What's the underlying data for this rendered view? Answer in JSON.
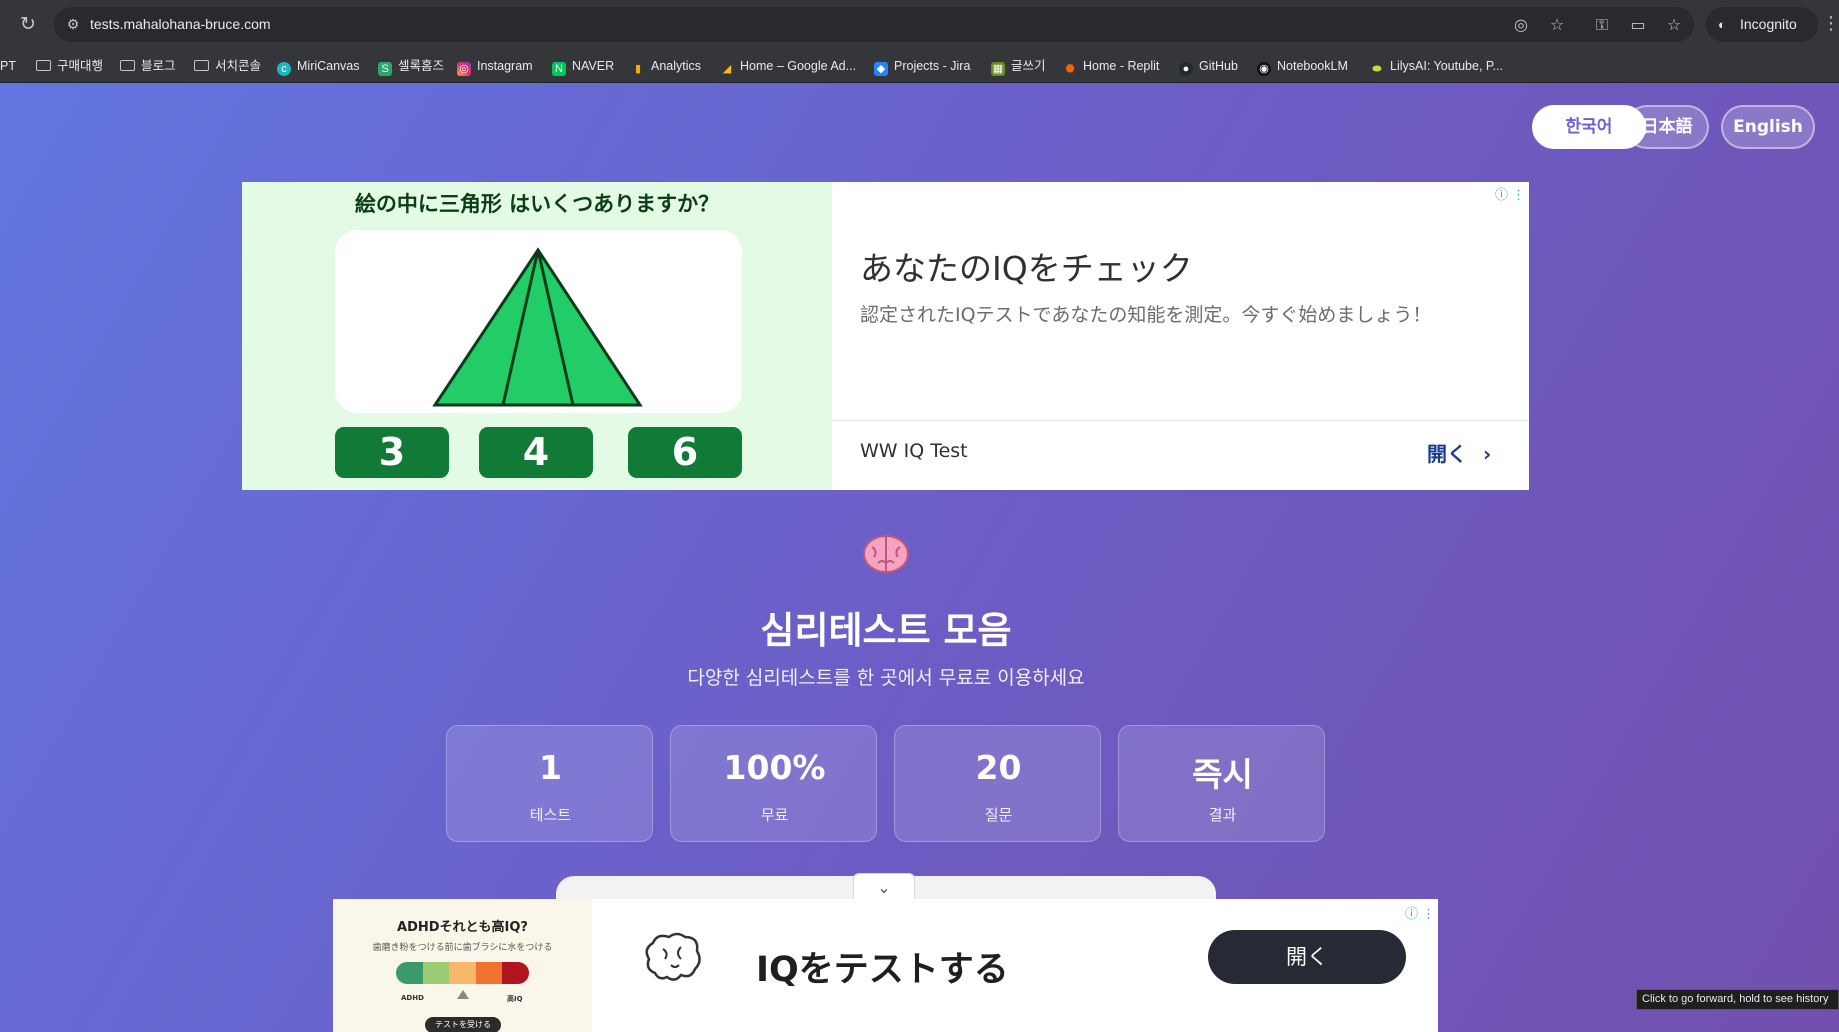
{
  "browser": {
    "url": "tests.mahalohana-bruce.com",
    "incognito_label": "Incognito",
    "tooltip": "Click to go forward, hold to see history",
    "bookmarks": [
      {
        "label": "PT",
        "icon": "none"
      },
      {
        "label": "구매대행",
        "icon": "folder-icon"
      },
      {
        "label": "블로그",
        "icon": "folder-icon"
      },
      {
        "label": "서치콘솔",
        "icon": "folder-icon"
      },
      {
        "label": "MiriCanvas",
        "icon": "miricanvas-icon"
      },
      {
        "label": "셀록홈즈",
        "icon": "sellock-icon"
      },
      {
        "label": "Instagram",
        "icon": "instagram-icon"
      },
      {
        "label": "NAVER",
        "icon": "naver-icon"
      },
      {
        "label": "Analytics",
        "icon": "analytics-icon"
      },
      {
        "label": "Home – Google Ad...",
        "icon": "google-ads-icon"
      },
      {
        "label": "Projects - Jira",
        "icon": "jira-icon"
      },
      {
        "label": "글쓰기",
        "icon": "write-icon"
      },
      {
        "label": "Home - Replit",
        "icon": "replit-icon"
      },
      {
        "label": "GitHub",
        "icon": "github-icon"
      },
      {
        "label": "NotebookLM",
        "icon": "notebooklm-icon"
      },
      {
        "label": "LilysAI: Youtube, P...",
        "icon": "lilys-icon"
      }
    ]
  },
  "languages": [
    {
      "label": "한국어",
      "active": true
    },
    {
      "label": "日本語",
      "active": false
    },
    {
      "label": "English",
      "active": false
    }
  ],
  "ad_top": {
    "question": "絵の中に三角形 はいくつありますか？",
    "answers": [
      "3",
      "4",
      "6"
    ],
    "title": "あなたのIQをチェック",
    "description": "認定されたIQテストであなたの知能を測定。今すぐ始めましょう！",
    "brand": "WW IQ Test",
    "open_label": "開く"
  },
  "hero": {
    "title": "심리테스트 모음",
    "subtitle": "다양한 심리테스트를 한 곳에서 무료로 이용하세요"
  },
  "stats": [
    {
      "value": "1",
      "label": "테스트"
    },
    {
      "value": "100%",
      "label": "무료"
    },
    {
      "value": "20",
      "label": "질문"
    },
    {
      "value": "즉시",
      "label": "결과"
    }
  ],
  "ad_bottom": {
    "image_heading": "ADHDそれとも高IQ?",
    "image_sub": "歯磨き粉をつける前に歯ブラシに水をつける",
    "scale_low": "ADHD",
    "scale_high": "高IQ",
    "image_cta": "テストを受ける",
    "title": "IQをテストする",
    "open_label": "開く"
  },
  "colors": {
    "gradient_start": "#6275e0",
    "gradient_end": "#7150ad",
    "active_lang_text": "#6a63d6",
    "triangle_green": "#22c55e",
    "answer_green": "#117a37"
  }
}
